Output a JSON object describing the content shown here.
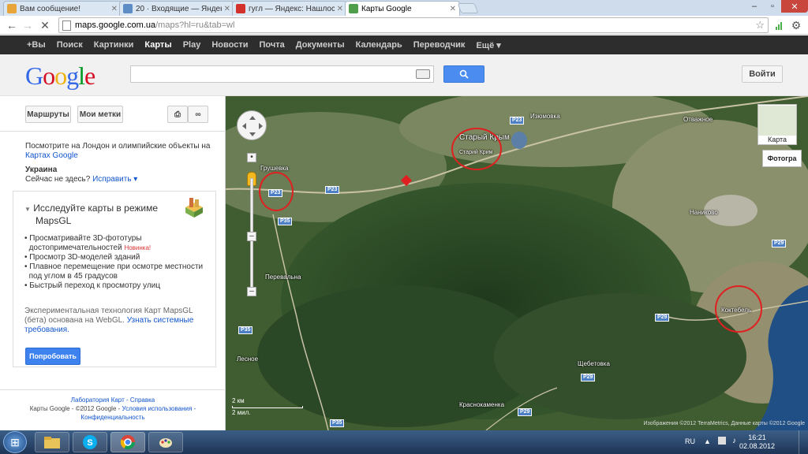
{
  "browser": {
    "tabs": [
      {
        "title": "Вам сообщение!",
        "favicon_color": "#e8a53a"
      },
      {
        "title": "20 · Входящие — Яндекс.П",
        "favicon_color": "#5e8cc4"
      },
      {
        "title": "гугл — Яндекс: Нашлось",
        "favicon_color": "#d3322c"
      },
      {
        "title": "Карты Google",
        "favicon_color": "#4f9e4a"
      }
    ],
    "url_host": "maps.google.com.ua",
    "url_path": "/maps?hl=ru&tab=wl"
  },
  "gbar": {
    "items": [
      "+Вы",
      "Поиск",
      "Картинки",
      "Карты",
      "Play",
      "Новости",
      "Почта",
      "Документы",
      "Календарь",
      "Переводчик",
      "Ещё ▾"
    ]
  },
  "header": {
    "logo_text": "Google",
    "search_value": "",
    "login_label": "Войти"
  },
  "left_panel": {
    "buttons": {
      "routes": "Маршруты",
      "my_places": "Мои метки"
    },
    "promo_text": "Посмотрите на Лондон и олимпийские объекты на",
    "promo_link": "Картах Google",
    "location_title": "Украина",
    "location_question": "Сейчас не здесь?",
    "location_fix": "Исправить ▾",
    "mapsgl": {
      "title_line1": "Исследуйте карты в режиме",
      "title_line2": "MapsGL",
      "bullets": [
        "Просматривайте 3D-фототуры",
        "достопримечательностей",
        "Просмотр 3D-моделей зданий",
        "Плавное перемещение при осмотре местности",
        "под углом в 45 градусов",
        "Быстрый переход к просмотру улиц"
      ],
      "new_badge": "Новинка!",
      "desc_line1": "Экспериментальная технология Карт MapsGL",
      "desc_line2": "(бета) основана на WebGL.",
      "desc_link1": "Узнать системные",
      "desc_link2": "требования.",
      "try_button": "Попробовать"
    },
    "footer_line1": "Лаборатория Карт - Справка",
    "footer_line2": "Карты Google - ©2012 Google -",
    "footer_link": "Условия использования -",
    "footer_line3": "Конфиденциальность"
  },
  "map": {
    "type_buttons": {
      "map": "Карта",
      "photo": "Фотогра"
    },
    "labels": {
      "staryi_krym": "Старый Крым",
      "staryi_krym_sub": "Старий Крим",
      "grushevka": "Грушевка",
      "pereval": "Перевальна",
      "lesnoe": "Лесное",
      "koktebel": "Коктебель",
      "shchebetovka": "Щебетовка",
      "krasnokamenka": "Краснокаменка",
      "otvazhnoe": "Отважное",
      "nanikovo": "Наниково",
      "izyumovka": "Изюмовка"
    },
    "roads": [
      "P23",
      "P23",
      "P23",
      "P35",
      "P35",
      "P35",
      "P29",
      "P29",
      "P29",
      "P29"
    ],
    "scale_km": "2 км",
    "scale_mi": "2 мил.",
    "copyright": "Изображения ©2012 TerraMetrics, Данные карты ©2012 Google"
  },
  "taskbar": {
    "lang": "RU",
    "time": "16:21",
    "date": "02.08.2012"
  }
}
